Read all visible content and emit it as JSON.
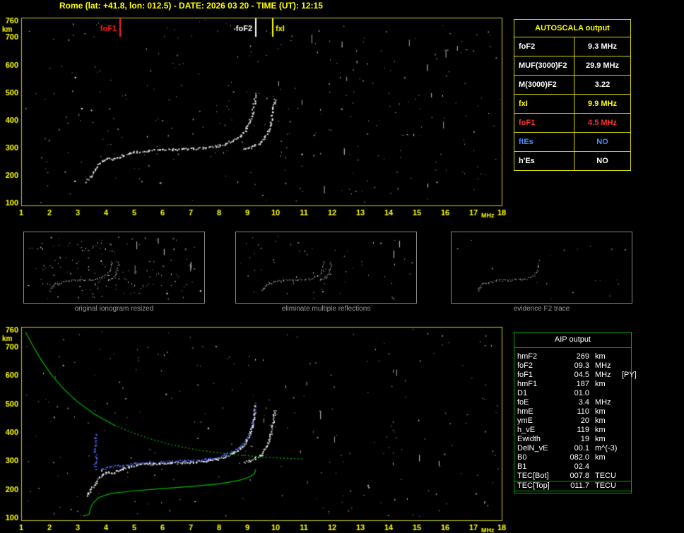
{
  "title": "Rome (lat: +41.8, lon: 012.5) - DATE: 2026 03 20 - TIME (UT): 12:15",
  "palette": {
    "axis": "#c8c820",
    "label": "#ffff00",
    "background": "#000000",
    "trace_white": "#ffffff",
    "trace_blue": "#4f6bff",
    "profile_green": "#00bb00",
    "caption_gray": "#9a9a9a"
  },
  "autoscala_table": {
    "header": "AUTOSCALA output",
    "rows": [
      {
        "param": "foF2",
        "value": "9.3 MHz",
        "color": "#ffffff"
      },
      {
        "param": "MUF(3000)F2",
        "value": "29.9 MHz",
        "color": "#ffffff"
      },
      {
        "param": "M(3000)F2",
        "value": "3.22",
        "color": "#ffffff"
      },
      {
        "param": "fxI",
        "value": "9.9 MHz",
        "color": "#ffff00"
      },
      {
        "param": "foF1",
        "value": "4.5 MHz",
        "color": "#ff3030"
      },
      {
        "param": "ftEs",
        "value": "NO",
        "color": "#4f8cff"
      },
      {
        "param": "h'Es",
        "value": "NO",
        "color": "#ffffff"
      }
    ]
  },
  "thumbnails": [
    {
      "caption": "original ionogram resized",
      "noise_dots": 160,
      "noise_streaks": 6,
      "series": [
        "O-mode trace",
        "X-mode trace"
      ]
    },
    {
      "caption": "eliminate multiple reflections",
      "noise_dots": 60,
      "noise_streaks": 2,
      "series": [
        "O-mode trace",
        "X-mode trace"
      ]
    },
    {
      "caption": "evidence F2 trace",
      "noise_dots": 18,
      "noise_streaks": 0,
      "series": [
        "O-mode trace"
      ]
    }
  ],
  "aip_table": {
    "header": "AIP output",
    "rows": [
      {
        "param": "hmF2",
        "value": "269",
        "unit": "km",
        "note": ""
      },
      {
        "param": "foF2",
        "value": "09.3",
        "unit": "MHz",
        "note": ""
      },
      {
        "param": "foF1",
        "value": "04.5",
        "unit": "MHz",
        "note": "[PY]"
      },
      {
        "param": "hmF1",
        "value": "187",
        "unit": "km",
        "note": ""
      },
      {
        "param": "D1",
        "value": "01.0",
        "unit": "",
        "note": ""
      },
      {
        "param": "foE",
        "value": "3.4",
        "unit": "MHz",
        "note": ""
      },
      {
        "param": "hmE",
        "value": "110",
        "unit": "km",
        "note": ""
      },
      {
        "param": "ymE",
        "value": "20",
        "unit": "km",
        "note": ""
      },
      {
        "param": "h_vE",
        "value": "119",
        "unit": "km",
        "note": ""
      },
      {
        "param": "Ewidth",
        "value": "19",
        "unit": "km",
        "note": ""
      },
      {
        "param": "DelN_vE",
        "value": "00.1",
        "unit": "m^(-3)",
        "note": ""
      },
      {
        "param": "B0",
        "value": "082.0",
        "unit": "km",
        "note": ""
      },
      {
        "param": "B1",
        "value": "02.4",
        "unit": "",
        "note": ""
      },
      {
        "param": "TEC[Bot]",
        "value": "007.8",
        "unit": "TECU",
        "note": ""
      },
      {
        "param": "TEC[Top]",
        "value": "011.7",
        "unit": "TECU",
        "note": ""
      }
    ]
  },
  "chart_data": [
    {
      "id": "ionogram_main",
      "type": "scatter",
      "xlabel": "MHz",
      "ylabel": "km",
      "xlim": [
        1,
        18
      ],
      "ylim": [
        100,
        760
      ],
      "x_ticks": [
        1,
        2,
        3,
        4,
        5,
        6,
        7,
        8,
        9,
        10,
        11,
        12,
        13,
        14,
        15,
        16,
        17,
        18
      ],
      "y_ticks": [
        100,
        200,
        300,
        400,
        500,
        600,
        700,
        760
      ],
      "grid": false,
      "noise_seed": 7,
      "noise": {
        "dots": 300,
        "streaks": 16
      },
      "frequency_markers": [
        {
          "label": "foF1",
          "freq": 4.5,
          "color": "#ff2020",
          "label_side": "left"
        },
        {
          "label": "foF2",
          "freq": 9.3,
          "color": "#ffffff",
          "label_side": "left"
        },
        {
          "label": "fxI",
          "freq": 9.9,
          "color": "#ffff00",
          "label_side": "right"
        }
      ],
      "series": [
        {
          "name": "O-mode trace",
          "color": "#ffffff",
          "style": "dots",
          "points": [
            [
              3.3,
              178
            ],
            [
              3.45,
              198
            ],
            [
              3.6,
              220
            ],
            [
              3.75,
              242
            ],
            [
              3.9,
              255
            ],
            [
              4.05,
              262
            ],
            [
              4.2,
              258
            ],
            [
              4.35,
              263
            ],
            [
              4.55,
              272
            ],
            [
              4.8,
              280
            ],
            [
              5.1,
              286
            ],
            [
              5.5,
              290
            ],
            [
              5.9,
              292
            ],
            [
              6.3,
              293
            ],
            [
              6.7,
              295
            ],
            [
              7.1,
              297
            ],
            [
              7.5,
              300
            ],
            [
              7.9,
              306
            ],
            [
              8.2,
              315
            ],
            [
              8.5,
              327
            ],
            [
              8.75,
              344
            ],
            [
              8.95,
              368
            ],
            [
              9.08,
              396
            ],
            [
              9.17,
              428
            ],
            [
              9.23,
              462
            ],
            [
              9.27,
              495
            ]
          ]
        },
        {
          "name": "X-mode trace",
          "color": "#ffffff",
          "style": "dots",
          "points": [
            [
              8.85,
              295
            ],
            [
              9.05,
              300
            ],
            [
              9.25,
              308
            ],
            [
              9.45,
              320
            ],
            [
              9.6,
              338
            ],
            [
              9.72,
              362
            ],
            [
              9.81,
              392
            ],
            [
              9.88,
              426
            ],
            [
              9.93,
              460
            ],
            [
              9.96,
              480
            ]
          ]
        }
      ]
    },
    {
      "id": "ionogram_profile",
      "type": "scatter",
      "xlabel": "MHz",
      "ylabel": "km",
      "xlim": [
        1,
        18
      ],
      "ylim": [
        100,
        760
      ],
      "x_ticks": [
        1,
        2,
        3,
        4,
        5,
        6,
        7,
        8,
        9,
        10,
        11,
        12,
        13,
        14,
        15,
        16,
        17,
        18
      ],
      "y_ticks": [
        100,
        200,
        300,
        400,
        500,
        600,
        700,
        760
      ],
      "grid": false,
      "noise_seed": 13,
      "noise": {
        "dots": 230,
        "streaks": 12
      },
      "series": [
        {
          "name": "restored trace blue",
          "color": "#4f6bff",
          "style": "dots",
          "points": [
            [
              3.8,
              272
            ],
            [
              4.1,
              278
            ],
            [
              4.5,
              285
            ],
            [
              5.0,
              291
            ],
            [
              5.5,
              295
            ],
            [
              6.0,
              297
            ],
            [
              6.5,
              299
            ],
            [
              7.0,
              301
            ],
            [
              7.5,
              305
            ],
            [
              7.9,
              312
            ],
            [
              8.2,
              321
            ],
            [
              8.5,
              333
            ],
            [
              8.75,
              350
            ],
            [
              8.95,
              374
            ],
            [
              9.08,
              402
            ],
            [
              9.17,
              434
            ],
            [
              9.23,
              468
            ],
            [
              9.27,
              500
            ]
          ]
        },
        {
          "name": "trace vertical spread blue",
          "color": "#4f6bff",
          "style": "dots",
          "points": [
            [
              3.62,
              268
            ],
            [
              3.6,
              290
            ],
            [
              3.63,
              312
            ],
            [
              3.59,
              334
            ],
            [
              3.62,
              356
            ],
            [
              3.6,
              378
            ],
            [
              3.62,
              395
            ]
          ]
        },
        {
          "name": "O-mode trace",
          "color": "#ffffff",
          "style": "dots",
          "points": [
            [
              3.3,
              178
            ],
            [
              3.45,
              198
            ],
            [
              3.6,
              220
            ],
            [
              3.75,
              242
            ],
            [
              3.9,
              255
            ],
            [
              4.05,
              262
            ],
            [
              4.2,
              258
            ],
            [
              4.35,
              263
            ],
            [
              4.55,
              272
            ],
            [
              4.8,
              280
            ],
            [
              5.1,
              286
            ],
            [
              5.5,
              290
            ],
            [
              5.9,
              292
            ],
            [
              6.3,
              293
            ],
            [
              6.7,
              295
            ],
            [
              7.1,
              297
            ],
            [
              7.5,
              300
            ],
            [
              7.9,
              306
            ],
            [
              8.2,
              315
            ],
            [
              8.5,
              327
            ],
            [
              8.75,
              344
            ],
            [
              8.95,
              368
            ],
            [
              9.08,
              396
            ],
            [
              9.17,
              428
            ],
            [
              9.23,
              462
            ],
            [
              9.27,
              495
            ]
          ]
        },
        {
          "name": "X-mode trace",
          "color": "#ffffff",
          "style": "dots",
          "points": [
            [
              8.85,
              295
            ],
            [
              9.05,
              300
            ],
            [
              9.25,
              308
            ],
            [
              9.45,
              320
            ],
            [
              9.6,
              338
            ],
            [
              9.72,
              362
            ],
            [
              9.81,
              392
            ],
            [
              9.88,
              426
            ],
            [
              9.93,
              460
            ],
            [
              9.96,
              480
            ]
          ]
        },
        {
          "name": "electron density profile topside",
          "color": "#00bb00",
          "style": "line",
          "points": [
            [
              1.15,
              752
            ],
            [
              1.4,
              706
            ],
            [
              1.7,
              655
            ],
            [
              2.05,
              604
            ],
            [
              2.5,
              552
            ],
            [
              3.0,
              506
            ],
            [
              3.6,
              463
            ],
            [
              4.3,
              424
            ]
          ]
        },
        {
          "name": "electron density profile topside extrapolated",
          "color": "#00bb00",
          "style": "dashed",
          "points": [
            [
              4.3,
              424
            ],
            [
              5.2,
              388
            ],
            [
              6.2,
              358
            ],
            [
              7.3,
              336
            ],
            [
              8.6,
              320
            ],
            [
              9.9,
              310
            ],
            [
              11.0,
              305
            ]
          ]
        },
        {
          "name": "electron density profile bottomside",
          "color": "#00bb00",
          "style": "line",
          "points": [
            [
              9.3,
              269
            ],
            [
              9.26,
              256
            ],
            [
              9.12,
              244
            ],
            [
              8.7,
              230
            ],
            [
              8.0,
              218
            ],
            [
              7.0,
              209
            ],
            [
              5.9,
              201
            ],
            [
              4.9,
              193
            ],
            [
              4.15,
              184
            ],
            [
              3.75,
              170
            ],
            [
              3.55,
              152
            ],
            [
              3.47,
              136
            ],
            [
              3.43,
              122
            ],
            [
              3.4,
              111
            ],
            [
              3.28,
              107
            ],
            [
              3.18,
              105
            ]
          ]
        }
      ]
    }
  ]
}
